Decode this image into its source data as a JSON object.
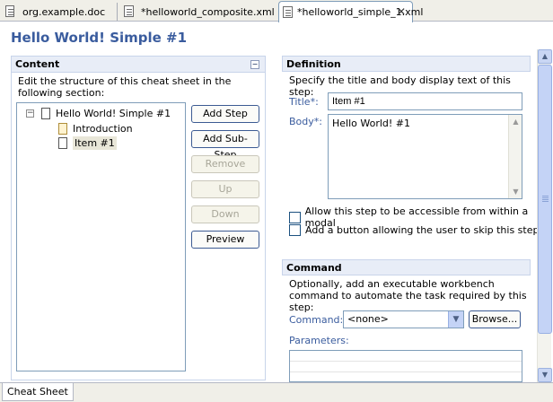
{
  "tabs": [
    {
      "label": "org.example.doc",
      "icon": "document-icon"
    },
    {
      "label": "*helloworld_composite.xml",
      "icon": "xml-file-icon"
    },
    {
      "label": "*helloworld_simple_1.xml",
      "icon": "xml-file-icon",
      "active": true
    }
  ],
  "page": {
    "title": "Hello World! Simple #1"
  },
  "content": {
    "title": "Content",
    "description": "Edit the structure of this cheat sheet in the following section:",
    "tree": {
      "root": "Hello World! Simple #1",
      "items": [
        "Introduction",
        "Item #1"
      ],
      "selected": "Item #1"
    },
    "buttons": {
      "add_step": "Add Step",
      "add_sub_step": "Add Sub-Step",
      "remove": "Remove",
      "up": "Up",
      "down": "Down",
      "preview": "Preview"
    }
  },
  "definition": {
    "title": "Definition",
    "description": "Specify the title and body display text of this step:",
    "title_label": "Title*:",
    "title_value": "Item #1",
    "body_label": "Body*:",
    "body_value": "Hello World! #1",
    "check_accessible": "Allow this step to be accessible from within a modal",
    "check_skip": "Add a button allowing the user to skip this step"
  },
  "command": {
    "title": "Command",
    "description": "Optionally, add an executable workbench command to automate the task required by this step:",
    "command_label": "Command:",
    "command_value": "<none>",
    "browse": "Browse...",
    "parameters_label": "Parameters:"
  },
  "bottom_tab": "Cheat Sheet",
  "colors": {
    "accent": "#3a5c9e",
    "section_head": "#e8edf7",
    "border": "#7f9db9"
  }
}
